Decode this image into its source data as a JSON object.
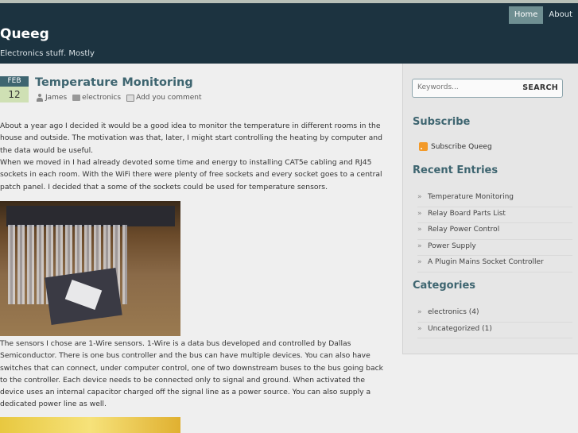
{
  "site": {
    "title": "Queeg",
    "description": "Electronics stuff. Mostly"
  },
  "nav": [
    {
      "label": "Home",
      "active": true
    },
    {
      "label": "About",
      "active": false
    }
  ],
  "post": {
    "date_month": "FEB",
    "date_day": "12",
    "title": "Temperature Monitoring",
    "author": "James",
    "category": "electronics",
    "comment_link": "Add you comment",
    "para1": "About a year ago I decided it would be a good idea to monitor the temperature in different rooms in the house and outside. The motivation was that, later, I might start controlling the heating by computer and the data would be useful.",
    "para2": "When we moved in I had already devoted some time and energy to installing CAT5e cabling and RJ45 sockets in each room. With the WiFi there were plenty of free sockets and every socket goes to a central patch panel. I decided that a some of the sockets could be used for temperature sensors.",
    "para3": "The sensors I chose are 1-Wire sensors. 1-Wire is a data bus developed and controlled by Dallas Semiconductor. There is one bus controller and the bus can have multiple devices. You can also have switches that can connect, under computer control, one of two downstream buses to the bus going back to the controller. Each device needs to be connected only to signal and ground. When activated the device uses an internal capacitor charged off the signal line as a power source. You can also supply a dedicated power line as well."
  },
  "sidebar": {
    "search_placeholder": "Keywords...",
    "search_button": "SEARCH",
    "subscribe_title": "Subscribe",
    "subscribe_link": "Subscribe Queeg",
    "recent_title": "Recent Entries",
    "recent": [
      "Temperature Monitoring",
      "Relay Board Parts List",
      "Relay Power Control",
      "Power Supply",
      "A Plugin Mains Socket Controller"
    ],
    "categories_title": "Categories",
    "categories": [
      "electronics (4)",
      "Uncategorized (1)"
    ]
  }
}
